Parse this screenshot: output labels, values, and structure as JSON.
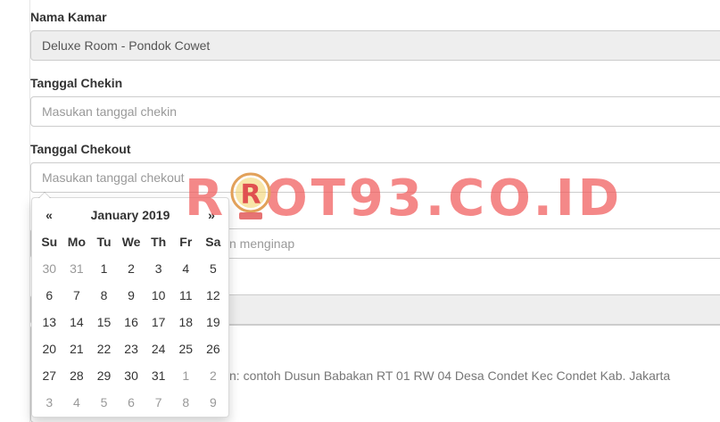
{
  "form": {
    "room_label": "Nama Kamar",
    "room_value": "Deluxe Room - Pondok Cowet",
    "checkin_label": "Tanggal Chekin",
    "checkin_placeholder": "Masukan tanggal chekin",
    "checkout_label": "Tanggal Chekout",
    "checkout_placeholder": "Masukan tanggal chekout",
    "stay_fragment": "n menginap",
    "address_fragment": "n: contoh Dusun Babakan RT 01 RW 04 Desa Condet Kec Condet Kab. Jakarta"
  },
  "datepicker": {
    "prev": "«",
    "title": "January 2019",
    "next": "»",
    "days_of_week": [
      "Su",
      "Mo",
      "Tu",
      "We",
      "Th",
      "Fr",
      "Sa"
    ],
    "weeks": [
      [
        "30",
        "31",
        "1",
        "2",
        "3",
        "4",
        "5"
      ],
      [
        "6",
        "7",
        "8",
        "9",
        "10",
        "11",
        "12"
      ],
      [
        "13",
        "14",
        "15",
        "16",
        "17",
        "18",
        "19"
      ],
      [
        "20",
        "21",
        "22",
        "23",
        "24",
        "25",
        "26"
      ],
      [
        "27",
        "28",
        "29",
        "30",
        "31",
        "1",
        "2"
      ],
      [
        "3",
        "4",
        "5",
        "6",
        "7",
        "8",
        "9"
      ]
    ],
    "muted": [
      [
        true,
        true,
        false,
        false,
        false,
        false,
        false
      ],
      [
        false,
        false,
        false,
        false,
        false,
        false,
        false
      ],
      [
        false,
        false,
        false,
        false,
        false,
        false,
        false
      ],
      [
        false,
        false,
        false,
        false,
        false,
        false,
        false
      ],
      [
        false,
        false,
        false,
        false,
        false,
        true,
        true
      ],
      [
        true,
        true,
        true,
        true,
        true,
        true,
        true
      ]
    ]
  },
  "watermark": {
    "text": "ROOT93.CO.ID",
    "color": "#f05a5a"
  }
}
